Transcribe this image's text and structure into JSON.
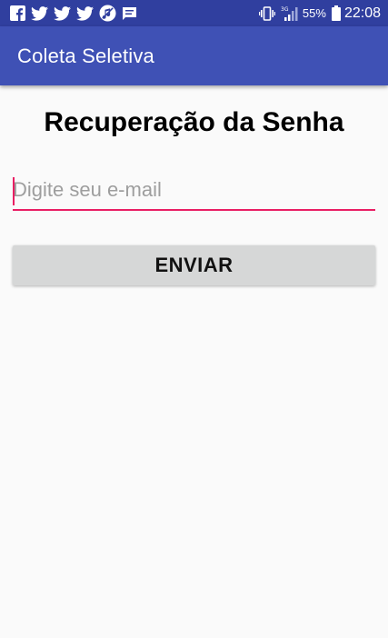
{
  "status_bar": {
    "notification_icons": [
      "facebook-icon",
      "twitter-icon",
      "twitter-icon",
      "twitter-icon",
      "music-disabled-icon",
      "message-icon"
    ],
    "system_icons": [
      "vibrate-icon",
      "signal-3g-icon",
      "battery-icon"
    ],
    "network_label": "3G",
    "battery_percent": "55%",
    "time": "22:08"
  },
  "app_bar": {
    "title": "Coleta Seletiva"
  },
  "main": {
    "title": "Recuperação da Senha",
    "email_placeholder": "Digite seu e-mail",
    "email_value": "",
    "send_label": "ENVIAR"
  },
  "colors": {
    "status_bar": "#303f9f",
    "app_bar": "#3f51b5",
    "accent": "#e91e63",
    "button": "#d6d7d7",
    "background": "#fafafa"
  }
}
